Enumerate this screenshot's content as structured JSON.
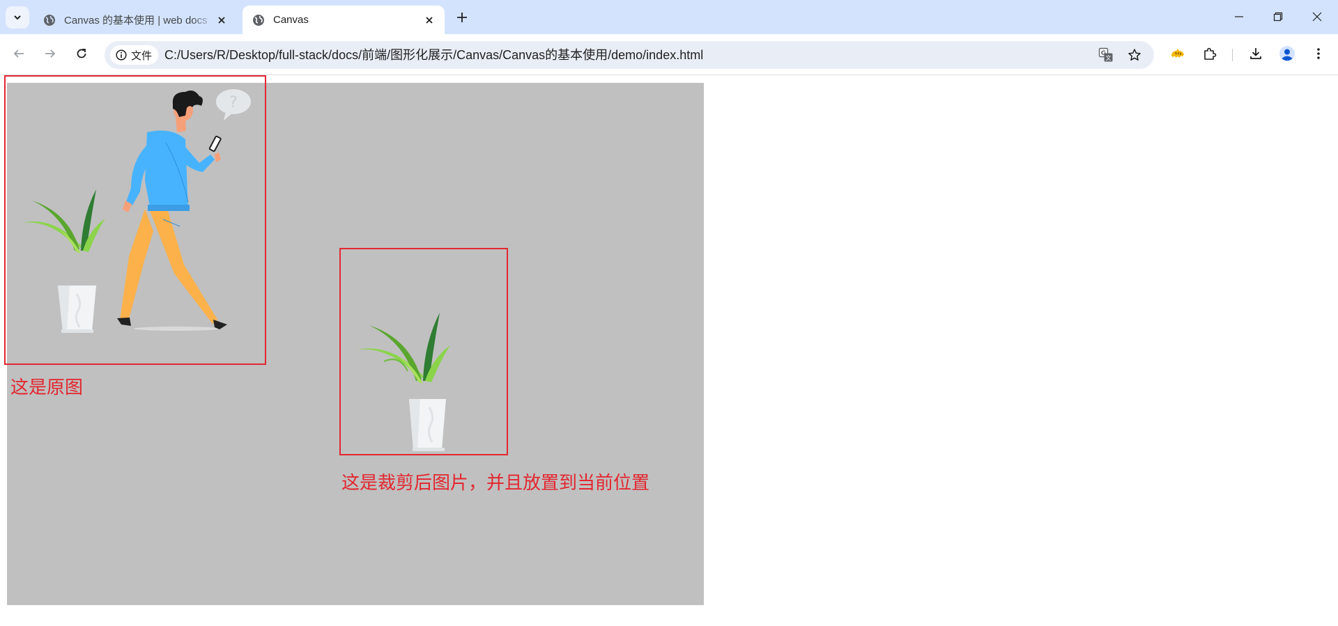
{
  "browser": {
    "tabs": [
      {
        "title": "Canvas 的基本使用 | web docs",
        "active": false
      },
      {
        "title": "Canvas",
        "active": true
      }
    ],
    "address_chip": "文件",
    "url": "C:/Users/R/Desktop/full-stack/docs/前端/图形化展示/Canvas/Canvas的基本使用/demo/index.html"
  },
  "page": {
    "canvas_background": "#c0c0c0",
    "annotation_color": "#e3262f",
    "original_caption": "这是原图",
    "cropped_caption": "这是裁剪后图片，并且放置到当前位置"
  }
}
